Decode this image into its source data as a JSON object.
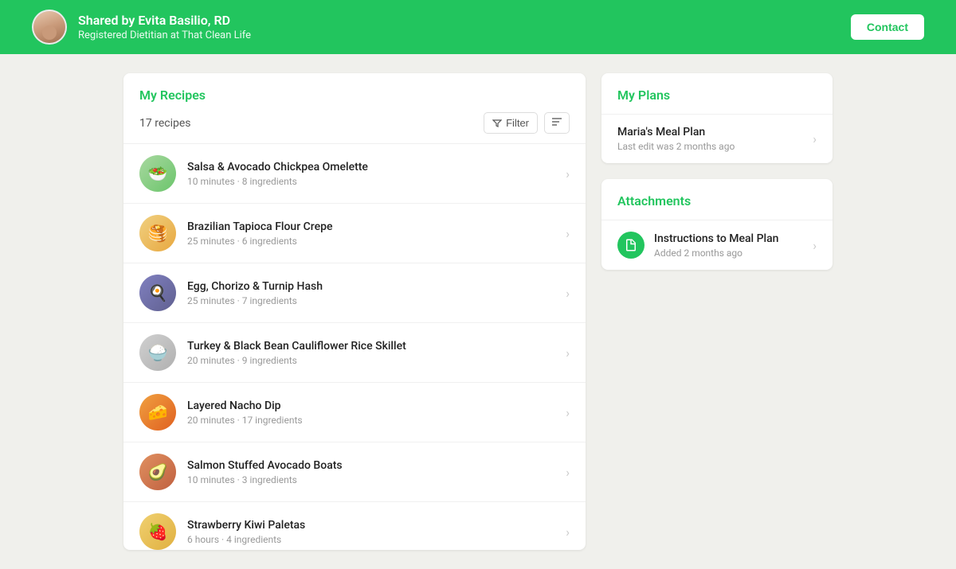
{
  "header": {
    "shared_by": "Shared by Evita Basilio, RD",
    "subtitle": "Registered Dietitian at That Clean Life",
    "contact_label": "Contact"
  },
  "recipes_panel": {
    "title": "My Recipes",
    "count": "17 recipes",
    "filter_label": "Filter"
  },
  "recipes": [
    {
      "name": "Salsa & Avocado Chickpea Omelette",
      "meta": "10 minutes · 8 ingredients",
      "emoji": "🥗",
      "thumb_class": "thumb-1"
    },
    {
      "name": "Brazilian Tapioca Flour Crepe",
      "meta": "25 minutes · 6 ingredients",
      "emoji": "🥞",
      "thumb_class": "thumb-2"
    },
    {
      "name": "Egg, Chorizo & Turnip Hash",
      "meta": "25 minutes · 7 ingredients",
      "emoji": "🍳",
      "thumb_class": "thumb-3"
    },
    {
      "name": "Turkey & Black Bean Cauliflower Rice Skillet",
      "meta": "20 minutes · 9 ingredients",
      "emoji": "🍚",
      "thumb_class": "thumb-4"
    },
    {
      "name": "Layered Nacho Dip",
      "meta": "20 minutes · 17 ingredients",
      "emoji": "🧀",
      "thumb_class": "thumb-5"
    },
    {
      "name": "Salmon Stuffed Avocado Boats",
      "meta": "10 minutes · 3 ingredients",
      "emoji": "🥑",
      "thumb_class": "thumb-6"
    },
    {
      "name": "Strawberry Kiwi Paletas",
      "meta": "6 hours · 4 ingredients",
      "emoji": "🍓",
      "thumb_class": "thumb-7"
    }
  ],
  "plans_panel": {
    "title": "My Plans",
    "items": [
      {
        "name": "Maria's Meal Plan",
        "meta": "Last edit was 2 months ago"
      }
    ]
  },
  "attachments_panel": {
    "title": "Attachments",
    "items": [
      {
        "name": "Instructions to Meal Plan",
        "meta": "Added 2 months ago"
      }
    ]
  }
}
